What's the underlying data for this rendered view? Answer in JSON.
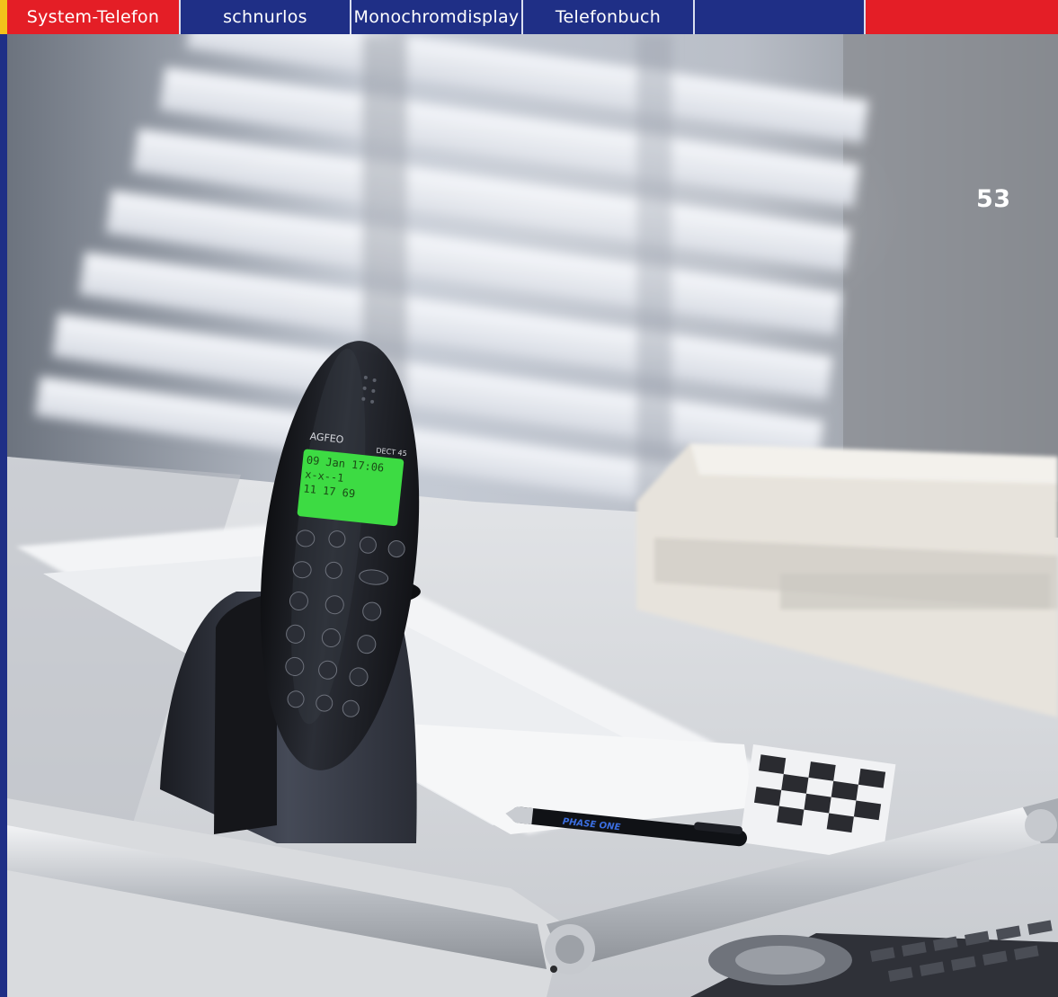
{
  "tabs": [
    {
      "label": "System-Telefon",
      "color": "#e41e26"
    },
    {
      "label": "schnurlos",
      "color": "#1f2f86"
    },
    {
      "label": "Monochromdisplay",
      "color": "#1f2f86"
    },
    {
      "label": "Telefonbuch",
      "color": "#1f2f86"
    },
    {
      "label": "",
      "color": "#1f2f86"
    },
    {
      "label": "",
      "color": "#e41e26"
    }
  ],
  "page_number": "53",
  "phone": {
    "brand": "AGFEO",
    "model": "DECT 45",
    "display_lines": [
      "09 Jan 17:06",
      "x-x--1",
      "11 17 69"
    ]
  },
  "pen_text": "PHASE ONE"
}
